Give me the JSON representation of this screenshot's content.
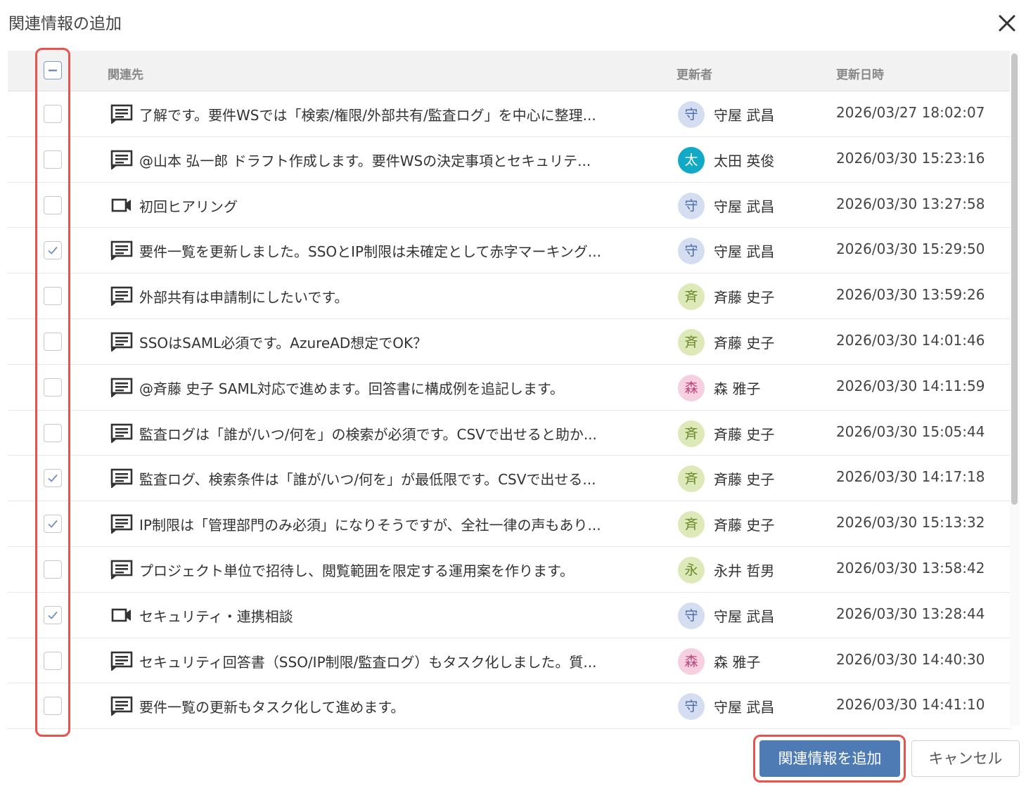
{
  "dialog": {
    "title": "関連情報の追加",
    "close_icon": "close-icon"
  },
  "table": {
    "headers": {
      "related": "関連先",
      "updater": "更新者",
      "updated_at": "更新日時"
    },
    "header_checkbox": "indeterminate",
    "rows": [
      {
        "checked": false,
        "type": "comment",
        "text": "了解です。要件WSでは「検索/権限/外部共有/監査ログ」を中心に整理...",
        "avatar": "守",
        "avatar_bg": "#d5def0",
        "avatar_fg": "#4a6aa8",
        "user": "守屋 武昌",
        "date": "2026/03/27 18:02:07"
      },
      {
        "checked": false,
        "type": "comment",
        "text": "@山本 弘一郎 ドラフト作成します。要件WSの決定事項とセキュリテ...",
        "avatar": "太",
        "avatar_bg": "#11a9c6",
        "avatar_fg": "#ffffff",
        "user": "太田 英俊",
        "date": "2026/03/30 15:23:16"
      },
      {
        "checked": false,
        "type": "meeting",
        "text": "初回ヒアリング",
        "avatar": "守",
        "avatar_bg": "#d5def0",
        "avatar_fg": "#4a6aa8",
        "user": "守屋 武昌",
        "date": "2026/03/30 13:27:58"
      },
      {
        "checked": true,
        "type": "comment",
        "text": "要件一覧を更新しました。SSOとIP制限は未確定として赤字マーキング...",
        "avatar": "守",
        "avatar_bg": "#d5def0",
        "avatar_fg": "#4a6aa8",
        "user": "守屋 武昌",
        "date": "2026/03/30 15:29:50"
      },
      {
        "checked": false,
        "type": "comment",
        "text": "外部共有は申請制にしたいです。",
        "avatar": "斉",
        "avatar_bg": "#dde9b8",
        "avatar_fg": "#6b8a2a",
        "user": "斉藤 史子",
        "date": "2026/03/30 13:59:26"
      },
      {
        "checked": false,
        "type": "comment",
        "text": "SSOはSAML必須です。AzureAD想定でOK？",
        "avatar": "斉",
        "avatar_bg": "#dde9b8",
        "avatar_fg": "#6b8a2a",
        "user": "斉藤 史子",
        "date": "2026/03/30 14:01:46"
      },
      {
        "checked": false,
        "type": "comment",
        "text": "@斉藤 史子 SAML対応で進めます。回答書に構成例を追記します。",
        "avatar": "森",
        "avatar_bg": "#f6cfe0",
        "avatar_fg": "#b8467a",
        "user": "森 雅子",
        "date": "2026/03/30 14:11:59"
      },
      {
        "checked": false,
        "type": "comment",
        "text": "監査ログは「誰が/いつ/何を」の検索が必須です。CSVで出せると助か...",
        "avatar": "斉",
        "avatar_bg": "#dde9b8",
        "avatar_fg": "#6b8a2a",
        "user": "斉藤 史子",
        "date": "2026/03/30 15:05:44"
      },
      {
        "checked": true,
        "type": "comment",
        "text": "監査ログ、検索条件は「誰が/いつ/何を」が最低限です。CSVで出せる...",
        "avatar": "斉",
        "avatar_bg": "#dde9b8",
        "avatar_fg": "#6b8a2a",
        "user": "斉藤 史子",
        "date": "2026/03/30 14:17:18"
      },
      {
        "checked": true,
        "type": "comment",
        "text": "IP制限は「管理部門のみ必須」になりそうですが、全社一律の声もあり...",
        "avatar": "斉",
        "avatar_bg": "#dde9b8",
        "avatar_fg": "#6b8a2a",
        "user": "斉藤 史子",
        "date": "2026/03/30 15:13:32"
      },
      {
        "checked": false,
        "type": "comment",
        "text": "プロジェクト単位で招待し、閲覧範囲を限定する運用案を作ります。",
        "avatar": "永",
        "avatar_bg": "#dde9b8",
        "avatar_fg": "#6b8a2a",
        "user": "永井 哲男",
        "date": "2026/03/30 13:58:42"
      },
      {
        "checked": true,
        "type": "meeting",
        "text": "セキュリティ・連携相談",
        "avatar": "守",
        "avatar_bg": "#d5def0",
        "avatar_fg": "#4a6aa8",
        "user": "守屋 武昌",
        "date": "2026/03/30 13:28:44"
      },
      {
        "checked": false,
        "type": "comment",
        "text": "セキュリティ回答書（SSO/IP制限/監査ログ）もタスク化しました。質...",
        "avatar": "森",
        "avatar_bg": "#f6cfe0",
        "avatar_fg": "#b8467a",
        "user": "森 雅子",
        "date": "2026/03/30 14:40:30"
      },
      {
        "checked": false,
        "type": "comment",
        "text": "要件一覧の更新もタスク化して進めます。",
        "avatar": "守",
        "avatar_bg": "#d5def0",
        "avatar_fg": "#4a6aa8",
        "user": "守屋 武昌",
        "date": "2026/03/30 14:41:10"
      }
    ]
  },
  "footer": {
    "add_label": "関連情報を追加",
    "cancel_label": "キャンセル"
  },
  "colors": {
    "primary": "#4f7bb5",
    "highlight": "#e8534f",
    "check": "#6f8fc4"
  }
}
